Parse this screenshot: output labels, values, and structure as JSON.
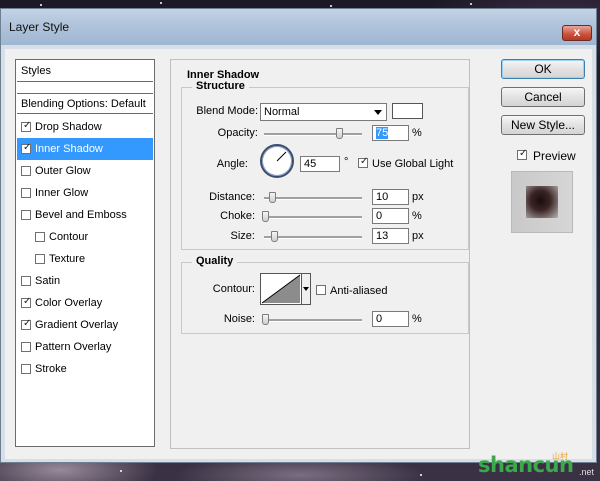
{
  "window": {
    "title": "Layer Style",
    "close_glyph": "x"
  },
  "styles_list": {
    "header": "Styles",
    "blending": "Blending Options: Default",
    "items": [
      {
        "label": "Drop Shadow",
        "checked": true,
        "selected": false,
        "indent": false
      },
      {
        "label": "Inner Shadow",
        "checked": true,
        "selected": true,
        "indent": false
      },
      {
        "label": "Outer Glow",
        "checked": false,
        "selected": false,
        "indent": false
      },
      {
        "label": "Inner Glow",
        "checked": false,
        "selected": false,
        "indent": false
      },
      {
        "label": "Bevel and Emboss",
        "checked": false,
        "selected": false,
        "indent": false
      },
      {
        "label": "Contour",
        "checked": false,
        "selected": false,
        "indent": true
      },
      {
        "label": "Texture",
        "checked": false,
        "selected": false,
        "indent": true
      },
      {
        "label": "Satin",
        "checked": false,
        "selected": false,
        "indent": false
      },
      {
        "label": "Color Overlay",
        "checked": true,
        "selected": false,
        "indent": false
      },
      {
        "label": "Gradient Overlay",
        "checked": true,
        "selected": false,
        "indent": false
      },
      {
        "label": "Pattern Overlay",
        "checked": false,
        "selected": false,
        "indent": false
      },
      {
        "label": "Stroke",
        "checked": false,
        "selected": false,
        "indent": false
      }
    ]
  },
  "inner_shadow": {
    "title": "Inner Shadow",
    "structure": {
      "legend": "Structure",
      "blend_mode_label": "Blend Mode:",
      "blend_mode_value": "Normal",
      "shadow_color": "#ffffff",
      "opacity_label": "Opacity:",
      "opacity_value": "75",
      "opacity_unit": "%",
      "angle_label": "Angle:",
      "angle_value": "45",
      "angle_unit": "°",
      "use_global_light_label": "Use Global Light",
      "use_global_light": true,
      "distance_label": "Distance:",
      "distance_value": "10",
      "distance_unit": "px",
      "choke_label": "Choke:",
      "choke_value": "0",
      "choke_unit": "%",
      "size_label": "Size:",
      "size_value": "13",
      "size_unit": "px"
    },
    "quality": {
      "legend": "Quality",
      "contour_label": "Contour:",
      "anti_aliased_label": "Anti-aliased",
      "anti_aliased": false,
      "noise_label": "Noise:",
      "noise_value": "0",
      "noise_unit": "%"
    }
  },
  "buttons": {
    "ok": "OK",
    "cancel": "Cancel",
    "new_style": "New Style...",
    "preview_label": "Preview",
    "preview_checked": true
  },
  "watermark": {
    "brand": "shancun",
    "tag": "山村",
    "suffix": ".net"
  }
}
